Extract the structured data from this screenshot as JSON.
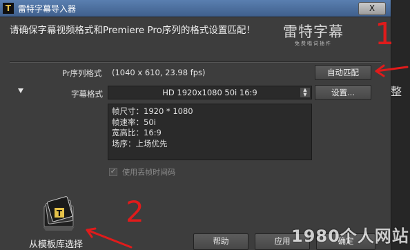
{
  "window": {
    "title": "雷特字幕导入器",
    "close_label": "X"
  },
  "header": {
    "message": "请确保字幕视频格式和Premiere Pro序列的格式设置匹配！",
    "logo_main": "雷特字幕",
    "logo_sub": "免费唱词插件"
  },
  "form": {
    "pr_sequence_label": "Pr序列格式",
    "pr_sequence_value": "(1040 x 610, 23.98 fps)",
    "auto_match_label": "自动匹配",
    "subtitle_format_label": "字幕格式",
    "subtitle_format_value": "HD 1920x1080 50i 16:9",
    "settings_label": "设置...",
    "info_lines": [
      "帧尺寸：1920 * 1080",
      "帧速率：50i",
      "宽高比：16:9",
      "场序：上场优先"
    ],
    "dropframe_label": "使用丢帧时间码",
    "dropframe_checked": true
  },
  "footer": {
    "template_label": "从模板库选择",
    "help_label": "帮助",
    "apply_label": "应用",
    "ok_label": "确定"
  },
  "annotations": {
    "one": "1",
    "two": "2",
    "color": "#e01b1b"
  },
  "side": {
    "partial_char": "整"
  },
  "watermark": "1980个人网站",
  "colors": {
    "dialog_bg": "#3d3d3d",
    "titlebar": "#4a6d9c",
    "annotation": "#e01b1b"
  }
}
